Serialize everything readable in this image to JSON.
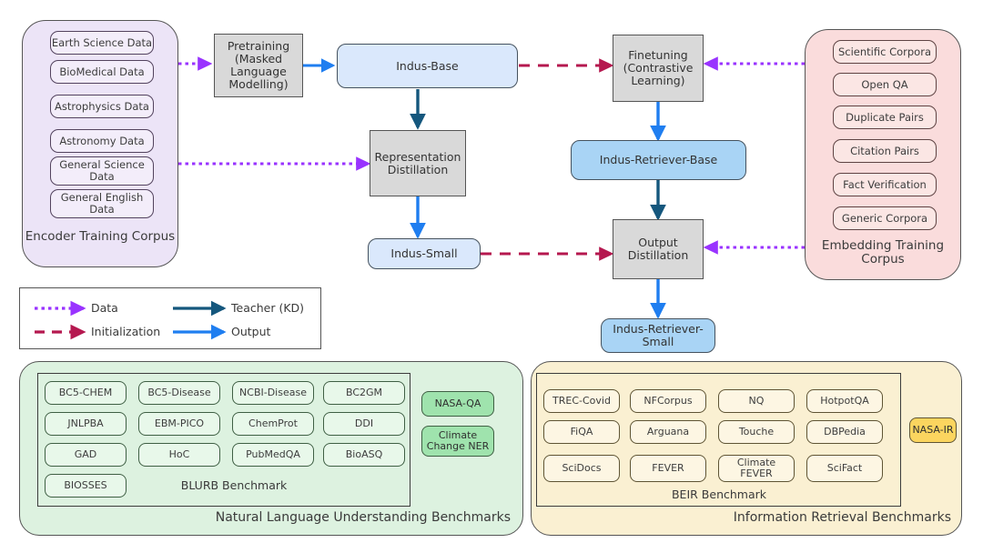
{
  "colors": {
    "data_arrow": "#9933ff",
    "init_arrow": "#b5184f",
    "teacher_arrow": "#15577d",
    "output_arrow": "#1f7ef0",
    "encoder_panel": "#ece4f7",
    "embedding_panel": "#fadcdc",
    "nlu_panel": "#ddf2e0",
    "ir_panel": "#faf0d2",
    "process_box": "#d9d9d9",
    "model_box": "#dae8fc",
    "model_box_strong": "#a9d4f5"
  },
  "encoder_corpus": {
    "caption": "Encoder Training Corpus",
    "items": [
      "Earth Science  Data",
      "BioMedical Data",
      "Astrophysics  Data",
      "Astronomy   Data",
      "General Science\nData",
      "General English\nData"
    ]
  },
  "embedding_corpus": {
    "caption": "Embedding Training\nCorpus",
    "items": [
      "Scientific Corpora",
      "Open QA",
      "Duplicate Pairs",
      "Citation Pairs",
      "Fact Verification",
      "Generic Corpora"
    ]
  },
  "flow": {
    "pretraining": "Pretraining\n(Masked\nLanguage\nModelling)",
    "indus_base": "Indus-Base",
    "finetuning": "Finetuning\n(Contrastive\nLearning)",
    "representation_distillation": "Representation\nDistillation",
    "indus_retriever_base": "Indus-Retriever-Base",
    "indus_small": "Indus-Small",
    "output_distillation": "Output\nDistillation",
    "indus_retriever_small": "Indus-Retriever-\nSmall"
  },
  "legend": {
    "items": [
      {
        "label": "Data",
        "style": "dotted",
        "color": "#9933ff"
      },
      {
        "label": "Initialization",
        "style": "dashed",
        "color": "#b5184f"
      },
      {
        "label": "Teacher (KD)",
        "style": "solid",
        "color": "#15577d"
      },
      {
        "label": "Output",
        "style": "solid",
        "color": "#1f7ef0"
      }
    ]
  },
  "nlu_benchmarks": {
    "caption": "Natural Language Understanding Benchmarks",
    "inner_caption": "BLURB Benchmark",
    "grid": [
      [
        "BC5-CHEM",
        "BC5-Disease",
        "NCBI-Disease",
        "BC2GM"
      ],
      [
        "JNLPBA",
        "EBM-PICO",
        "ChemProt",
        "DDI"
      ],
      [
        "GAD",
        "HoC",
        "PubMedQA",
        "BioASQ"
      ],
      [
        "BIOSSES",
        "",
        "",
        ""
      ]
    ],
    "side_items": [
      "NASA-QA",
      "Climate\nChange NER"
    ]
  },
  "ir_benchmarks": {
    "caption": "Information Retrieval Benchmarks",
    "inner_caption": "BEIR Benchmark",
    "grid": [
      [
        "TREC-Covid",
        "NFCorpus",
        "NQ",
        "HotpotQA"
      ],
      [
        "FiQA",
        "Arguana",
        "Touche",
        "DBPedia"
      ],
      [
        "SciDocs",
        "FEVER",
        "Climate\nFEVER",
        "SciFact"
      ]
    ],
    "side_items": [
      "NASA-IR"
    ]
  }
}
